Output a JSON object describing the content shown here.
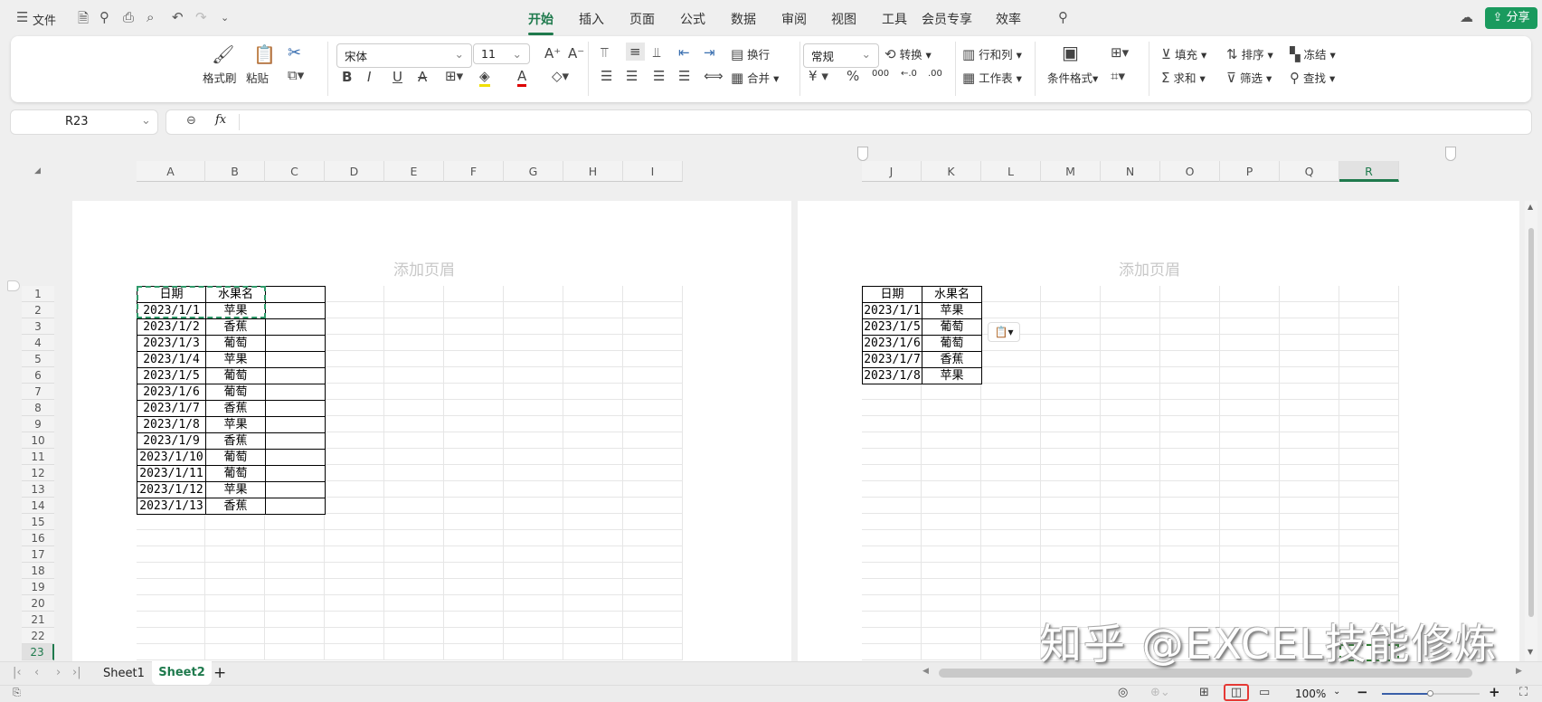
{
  "titlebar": {
    "menu": "文件",
    "tabs": [
      "开始",
      "插入",
      "页面",
      "公式",
      "数据",
      "审阅",
      "视图",
      "工具",
      "会员专享",
      "效率"
    ],
    "active_tab": "开始",
    "share": "分享"
  },
  "ribbon": {
    "format_painter": "格式刷",
    "paste": "粘贴",
    "font": "宋体",
    "font_size": "11",
    "wrap": "换行",
    "merge": "合并",
    "number_format": "常规",
    "convert": "转换",
    "rows_cols": "行和列",
    "worksheet": "工作表",
    "cond_format": "条件格式",
    "fill": "填充",
    "sort": "排序",
    "freeze": "冻结",
    "sum": "求和",
    "filter": "筛选",
    "find": "查找",
    "bold": "B",
    "italic": "I",
    "underline": "U",
    "currency": "¥",
    "percent": "%"
  },
  "formula": {
    "name_box": "R23",
    "fx": "fx",
    "value": ""
  },
  "columns_left": [
    "A",
    "B",
    "C",
    "D",
    "E",
    "F",
    "G",
    "H",
    "I"
  ],
  "columns_right": [
    "J",
    "K",
    "L",
    "M",
    "N",
    "O",
    "P",
    "Q",
    "R"
  ],
  "selected_column": "R",
  "rows": [
    "1",
    "2",
    "3",
    "4",
    "5",
    "6",
    "7",
    "8",
    "9",
    "10",
    "11",
    "12",
    "13",
    "14",
    "15",
    "16",
    "17",
    "18",
    "19",
    "20",
    "21",
    "22",
    "23"
  ],
  "selected_row": "23",
  "header_placeholder": "添加页眉",
  "table_left": [
    [
      "日期",
      "水果名"
    ],
    [
      "2023/1/1",
      "苹果"
    ],
    [
      "2023/1/2",
      "香蕉"
    ],
    [
      "2023/1/3",
      "葡萄"
    ],
    [
      "2023/1/4",
      "苹果"
    ],
    [
      "2023/1/5",
      "葡萄"
    ],
    [
      "2023/1/6",
      "葡萄"
    ],
    [
      "2023/1/7",
      "香蕉"
    ],
    [
      "2023/1/8",
      "苹果"
    ],
    [
      "2023/1/9",
      "香蕉"
    ],
    [
      "2023/1/10",
      "葡萄"
    ],
    [
      "2023/1/11",
      "葡萄"
    ],
    [
      "2023/1/12",
      "苹果"
    ],
    [
      "2023/1/13",
      "香蕉"
    ]
  ],
  "table_right": [
    [
      "日期",
      "水果名"
    ],
    [
      "2023/1/1",
      "苹果"
    ],
    [
      "2023/1/5",
      "葡萄"
    ],
    [
      "2023/1/6",
      "葡萄"
    ],
    [
      "2023/1/7",
      "香蕉"
    ],
    [
      "2023/1/8",
      "苹果"
    ]
  ],
  "sheets": [
    "Sheet1",
    "Sheet2"
  ],
  "active_sheet": "Sheet2",
  "status": {
    "zoom": "100%",
    "zoom_fraction": 0.5
  },
  "watermark": "知乎 @EXCEL技能修炼",
  "colors": {
    "accent": "#1f7a4d",
    "share_bg": "#1a9a5e",
    "highlight_red": "#e53935"
  }
}
